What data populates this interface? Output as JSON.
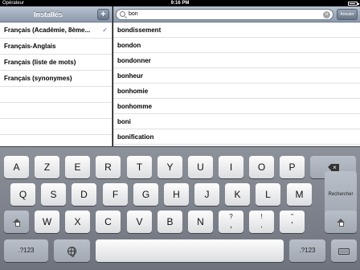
{
  "status": {
    "carrier": "Opérateur",
    "time": "9:16 PM"
  },
  "left_panel": {
    "title": "Installés",
    "add_label": "+",
    "items": [
      {
        "label": "Français (Académie, 8ème...",
        "checked": true
      },
      {
        "label": "Français-Anglais",
        "checked": false
      },
      {
        "label": "Français (liste de mots)",
        "checked": false
      },
      {
        "label": "Français (synonymes)",
        "checked": false
      }
    ],
    "check_glyph": "✓"
  },
  "search": {
    "value": "bon",
    "cancel_label": "Annuler",
    "clear_glyph": "×"
  },
  "results": [
    "bondissement",
    "bondon",
    "bondonner",
    "bonheur",
    "bonhomie",
    "bonhomme",
    "boni",
    "bonification"
  ],
  "keyboard": {
    "row1": [
      "A",
      "Z",
      "E",
      "R",
      "T",
      "Y",
      "U",
      "I",
      "O",
      "P"
    ],
    "row2": [
      "Q",
      "S",
      "D",
      "F",
      "G",
      "H",
      "J",
      "K",
      "L",
      "M"
    ],
    "search_key": "Rechercher",
    "row3": [
      "W",
      "X",
      "C",
      "V",
      "B",
      "N"
    ],
    "punct": [
      {
        "sub": "?",
        "main": ","
      },
      {
        "sub": "!",
        "main": "."
      },
      {
        "sub": "\"",
        "main": "'"
      }
    ],
    "numbers_key": ".?123",
    "icons": {
      "backspace": "backspace-icon",
      "shift": "shift-icon",
      "globe": "globe-icon",
      "hide": "keyboard-hide-icon"
    }
  }
}
